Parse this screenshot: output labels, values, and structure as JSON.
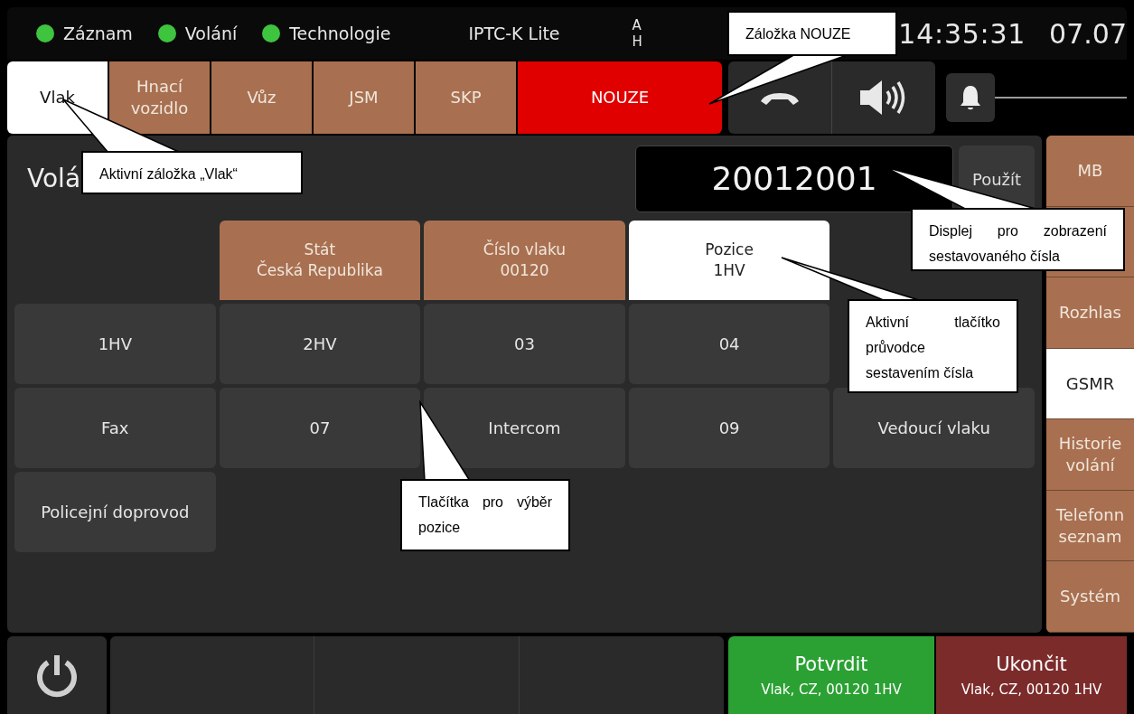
{
  "status_bar": {
    "indicators": [
      {
        "label": "Záznam",
        "color": "#3ec43e"
      },
      {
        "label": "Volání",
        "color": "#3ec43e"
      },
      {
        "label": "Technologie",
        "color": "#3ec43e"
      }
    ],
    "product": "IPTC-K Lite",
    "clipped_label": [
      "A",
      "H"
    ],
    "time": "14:35:31",
    "date": "07.07"
  },
  "tabs": [
    {
      "label": "Vlak",
      "kind": "normal",
      "selected": true
    },
    {
      "label": "Hnací vozidlo",
      "kind": "normal",
      "selected": false
    },
    {
      "label": "Vůz",
      "kind": "normal",
      "selected": false
    },
    {
      "label": "JSM",
      "kind": "normal",
      "selected": false
    },
    {
      "label": "SKP",
      "kind": "normal",
      "selected": false
    },
    {
      "label": "NOUZE",
      "kind": "emergency",
      "selected": false
    }
  ],
  "panel": {
    "title": "Volá",
    "display": "20012001",
    "apply_button": "Použít",
    "wizard": [
      {
        "label": "Stát",
        "value": "Česká Republika",
        "selected": false
      },
      {
        "label": "Číslo vlaku",
        "value": "00120",
        "selected": false
      },
      {
        "label": "Pozice",
        "value": "1HV",
        "selected": true
      }
    ],
    "positions": [
      [
        "1HV",
        "2HV",
        "03",
        "04"
      ],
      [
        "Fax",
        "07",
        "Intercom",
        "09",
        "Vedoucí vlaku"
      ],
      [
        "Policejní doprovod"
      ]
    ]
  },
  "sidebar": {
    "items": [
      {
        "label": "MB",
        "selected": false
      },
      {
        "label": "Rozhlas",
        "selected": false
      },
      {
        "label": "GSMR",
        "selected": true
      },
      {
        "label": "Historie volání",
        "selected": false
      },
      {
        "label": "Telefonn seznam",
        "selected": false
      },
      {
        "label": "Systém",
        "selected": false
      }
    ]
  },
  "bottom_bar": {
    "confirm": {
      "label": "Potvrdit",
      "detail": "Vlak, CZ, 00120 1HV"
    },
    "end": {
      "label": "Ukončit",
      "detail": "Vlak, CZ, 00120 1HV"
    }
  },
  "callouts": [
    "Záložka NOUZE",
    "Aktivní záložka „Vlak“",
    "Displej pro zobrazení sestavovaného čísla",
    "Aktivní tlačítko průvodce sestavením čísla",
    "Tlačítka pro výběr pozice"
  ]
}
